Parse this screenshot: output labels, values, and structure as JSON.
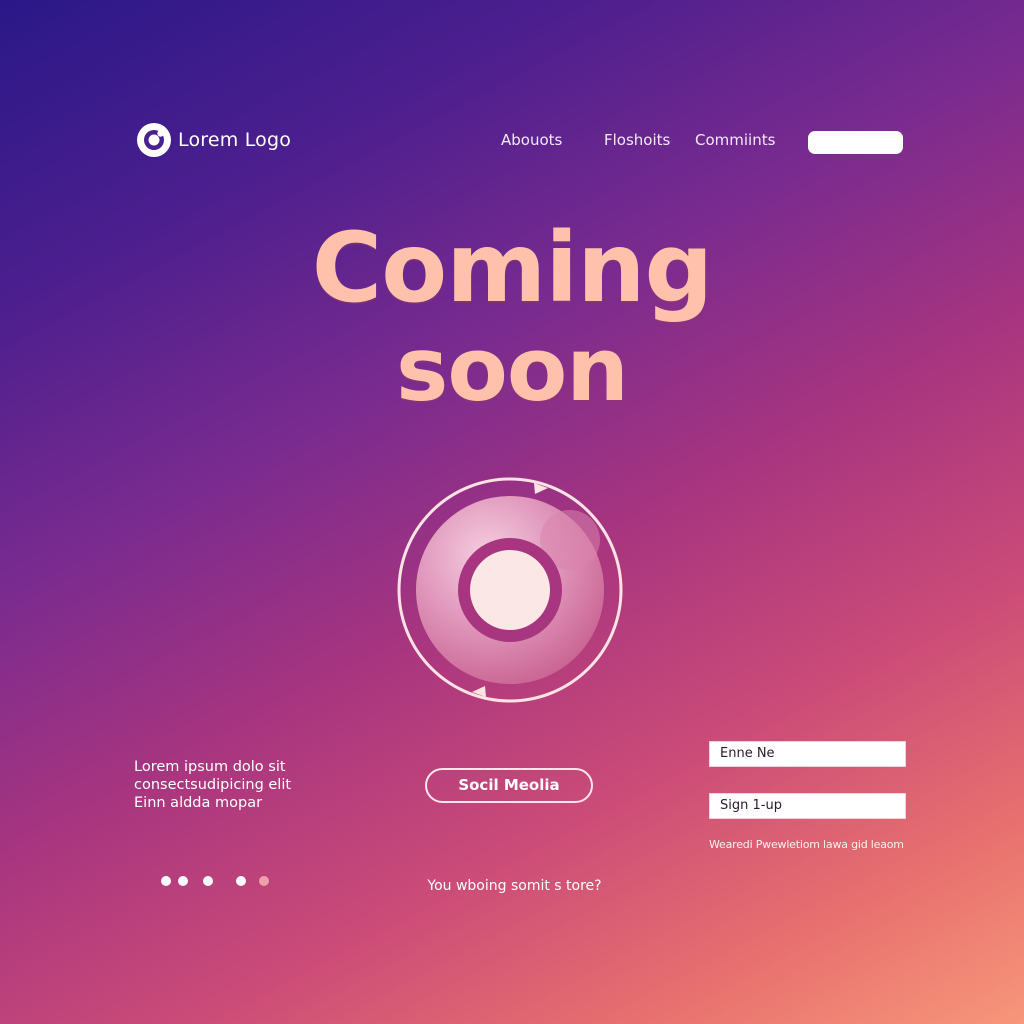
{
  "header": {
    "logo_text": "Lorem Logo",
    "nav": [
      {
        "label": "Abouots"
      },
      {
        "label": "Floshoits"
      },
      {
        "label": "Commiints"
      }
    ],
    "cta_label": ""
  },
  "hero": {
    "title_line1": "Coming",
    "title_line2": "soon"
  },
  "blurb": {
    "lines": [
      "Lorem ipsum dolo sit",
      "consectsudipicing elit",
      "Einn aldda mopar"
    ]
  },
  "social": {
    "button_label": "Socil Meolia"
  },
  "signup": {
    "email_value": "Enne Ne",
    "signup_label": "Sign 1-up",
    "fineprint": "Wearedi Pwewletiom lawa gid leaom"
  },
  "carousel": {
    "dots": 5,
    "active_count": 4
  },
  "footer": {
    "question": "You wboing somit s tore?"
  },
  "colors": {
    "gradient_start": "#2a1888",
    "gradient_end": "#f7967a",
    "headline": "#ffc0ac",
    "loader_ring": "#ffe2e2",
    "accent_pink": "#a8357f"
  },
  "icons": {
    "logo": "ring-logo-icon",
    "loader": "circular-refresh-loader-icon"
  }
}
